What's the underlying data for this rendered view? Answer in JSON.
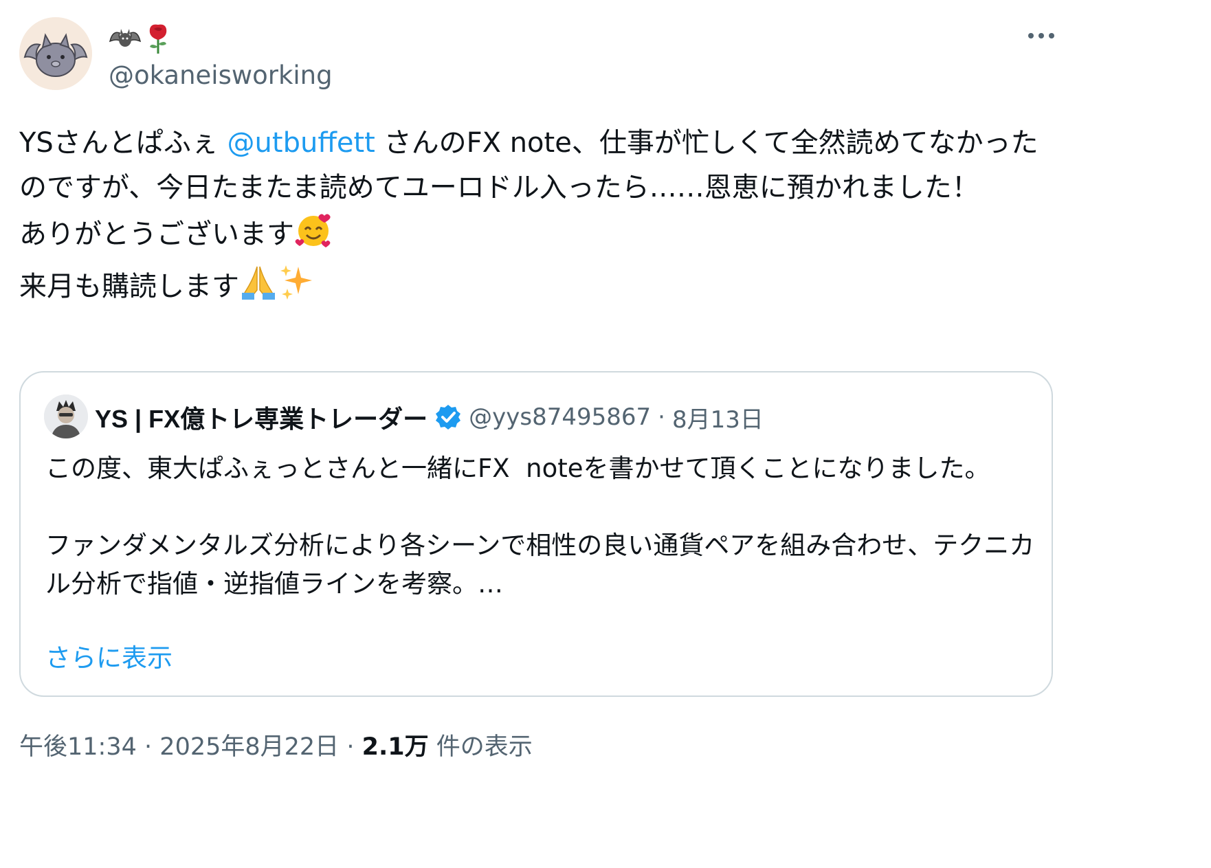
{
  "author": {
    "display_name_emojis": [
      "bat",
      "rose"
    ],
    "handle": "@okaneisworking"
  },
  "tweet": {
    "line1_a": "YSさんとぱふぇ ",
    "mention": "@utbuffett",
    "line1_b": " さんのFX note、仕事が忙しくて全然読めてなかったのですが、今日たまたま読めてユーロドル入ったら……恩恵に預かれました！\nありがとうございます",
    "line2_a": "\n来月も購読します",
    "emojis": [
      "smiling-face-with-hearts",
      "folded-hands",
      "sparkles"
    ]
  },
  "quote": {
    "name": "YS | FX億トレ専業トレーダー",
    "handle": "@yys87495867",
    "separator": "·",
    "date": "8月13日",
    "text": "この度、東大ぱふぇっとさんと一緒にFX  noteを書かせて頂くことになりました。\n\nファンダメンタルズ分析により各シーンで相性の良い通貨ペアを組み合わせ、テクニカル分析で指値・逆指値ラインを考察。…",
    "show_more": "さらに表示"
  },
  "footer": {
    "time": "午後11:34",
    "sep1": "·",
    "date": "2025年8月22日",
    "sep2": "·",
    "views": "2.1万",
    "views_label": "件の表示"
  },
  "colors": {
    "link": "#1d9bf0",
    "muted": "#536471",
    "text": "#0f1419",
    "border": "#cfd9de",
    "verified": "#1d9bf0"
  }
}
